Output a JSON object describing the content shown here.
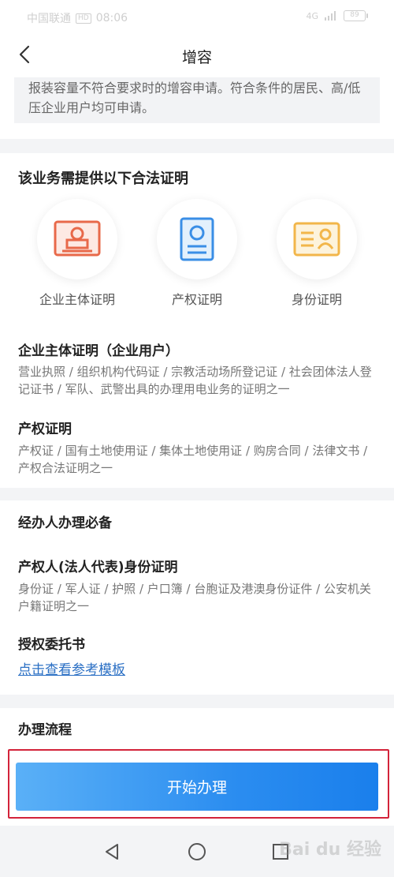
{
  "statusbar": {
    "carrier": "中国联通",
    "network": "HD",
    "time": "08:06",
    "signal": "4G",
    "battery": "89"
  },
  "header": {
    "title": "增容"
  },
  "intro": {
    "text": "报装容量不符合要求时的增容申请。符合条件的居民、高/低压企业用户均可申请。"
  },
  "requirements": {
    "title": "该业务需提供以下合法证明",
    "certs": [
      {
        "label": "企业主体证明",
        "icon": "business-license-icon"
      },
      {
        "label": "产权证明",
        "icon": "property-certificate-icon"
      },
      {
        "label": "身份证明",
        "icon": "id-card-icon"
      }
    ],
    "items": [
      {
        "title": "企业主体证明（企业用户）",
        "text": "营业执照 / 组织机构代码证 / 宗教活动场所登记证 / 社会团体法人登记证书 / 军队、武警出具的办理用电业务的证明之一"
      },
      {
        "title": "产权证明",
        "text": "产权证 / 国有土地使用证 / 集体土地使用证 / 购房合同 / 法律文书 / 产权合法证明之一"
      }
    ]
  },
  "agent": {
    "title": "经办人办理必备",
    "items": [
      {
        "title": "产权人(法人代表)身份证明",
        "text": "身份证 / 军人证 / 护照 / 户口簿 / 台胞证及港澳身份证件 / 公安机关户籍证明之一"
      },
      {
        "title": "授权委托书"
      }
    ],
    "link": "点击查看参考模板"
  },
  "process": {
    "title": "办理流程"
  },
  "action": {
    "start_label": "开始办理"
  },
  "watermark": "Bai du 经验",
  "colors": {
    "primary": "#2b8df0",
    "highlight": "#d3233a",
    "link": "#2a6fc4",
    "cert_orange": "#e8694a",
    "cert_blue": "#3a8ee6",
    "cert_yellow": "#f2b64a"
  }
}
